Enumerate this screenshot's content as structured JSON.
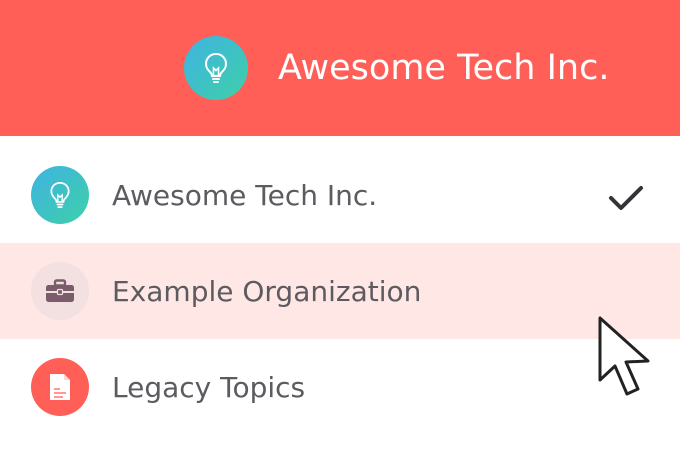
{
  "header": {
    "org_name": "Awesome Tech Inc.",
    "logo_icon": "lightbulb-icon",
    "background_color": "#ff5f57"
  },
  "menu": {
    "items": [
      {
        "label": "Awesome Tech Inc.",
        "icon": "lightbulb-icon",
        "selected": true,
        "hovered": false
      },
      {
        "label": "Example Organization",
        "icon": "briefcase-icon",
        "selected": false,
        "hovered": true
      },
      {
        "label": "Legacy Topics",
        "icon": "document-icon",
        "selected": false,
        "hovered": false
      }
    ],
    "selected_indicator_icon": "checkmark-icon",
    "hover_color": "#ffe7e6"
  },
  "pointer": {
    "icon": "mouse-pointer-icon"
  }
}
